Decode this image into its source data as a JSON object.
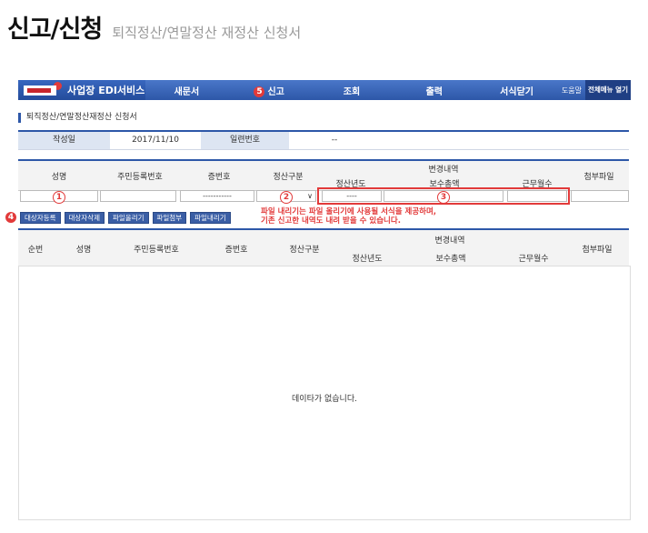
{
  "page": {
    "title_main": "신고/신청",
    "title_sub": "퇴직정산/연말정산 재정산 신청서"
  },
  "nav": {
    "brand": "사업장 EDI서비스",
    "items": [
      "새문서",
      "신고",
      "조회",
      "출력",
      "서식닫기"
    ],
    "help": "도움말",
    "all_menu": "전체메뉴 열기",
    "marker_5": "5"
  },
  "section": {
    "title": "퇴직정산/연말정산재정산 신청서"
  },
  "info": {
    "label_date": "작성일",
    "date": "2017/11/10",
    "label_serial": "일련번호",
    "serial": "--"
  },
  "form_header": {
    "name": "성명",
    "rrn": "주민등록번호",
    "cert_no": "증번호",
    "calc_type": "정산구분",
    "change": "변경내역",
    "year": "정산년도",
    "salary": "보수총액",
    "months": "근무월수",
    "attach": "첨부파일"
  },
  "input_row": {
    "marker_1": "1",
    "cert_value": "-----------",
    "marker_2": "2",
    "select_arrow": "∨",
    "year_value": "----",
    "marker_3": "3"
  },
  "buttons": {
    "marker_4": "4",
    "add": "대상자등록",
    "delete": "대상자삭제",
    "upload": "파일올리기",
    "attach": "파일첨부",
    "download": "파일내리기"
  },
  "warning": [
    "파일 내리기는 파일 올리기에 사용될 서식을 제공하며,",
    "기존 신고한 내역도 내려 받을 수 있습니다."
  ],
  "list_header": {
    "seq": "순번",
    "name": "성명",
    "rrn": "주민등록번호",
    "cert_no": "증번호",
    "calc_type": "정산구분",
    "change": "변경내역",
    "year": "정산년도",
    "salary": "보수총액",
    "months": "근무월수",
    "attach": "첨부파일"
  },
  "list": {
    "empty_message": "데이타가 없습니다."
  }
}
